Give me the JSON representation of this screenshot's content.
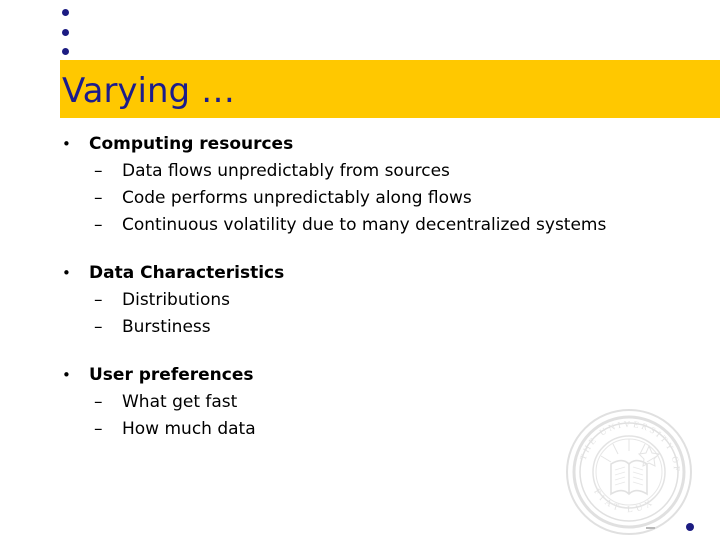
{
  "slide": {
    "title": "Varying …",
    "title_bar_color": "#ffc800",
    "title_text_color": "#1c1c8c",
    "background_color": "#ffffff",
    "body_text_color": "#000000",
    "decor_dot_color": "#1c1c82",
    "level1_marker": "•",
    "level2_marker": "–",
    "groups": [
      {
        "heading": "Computing resources",
        "items": [
          "Data flows unpredictably from sources",
          "Code performs unpredictably along flows",
          "Continuous volatility due to many decentralized systems"
        ]
      },
      {
        "heading": "Data Characteristics",
        "items": [
          "Distributions",
          "Burstiness"
        ]
      },
      {
        "heading": "User preferences",
        "items": [
          "What get fast",
          "How much data"
        ]
      }
    ],
    "watermark": {
      "name": "university-of-california-seal",
      "outer_text": "THE UNIVERSITY OF CALIFORNIA",
      "motto": "FIAT LUX"
    }
  }
}
